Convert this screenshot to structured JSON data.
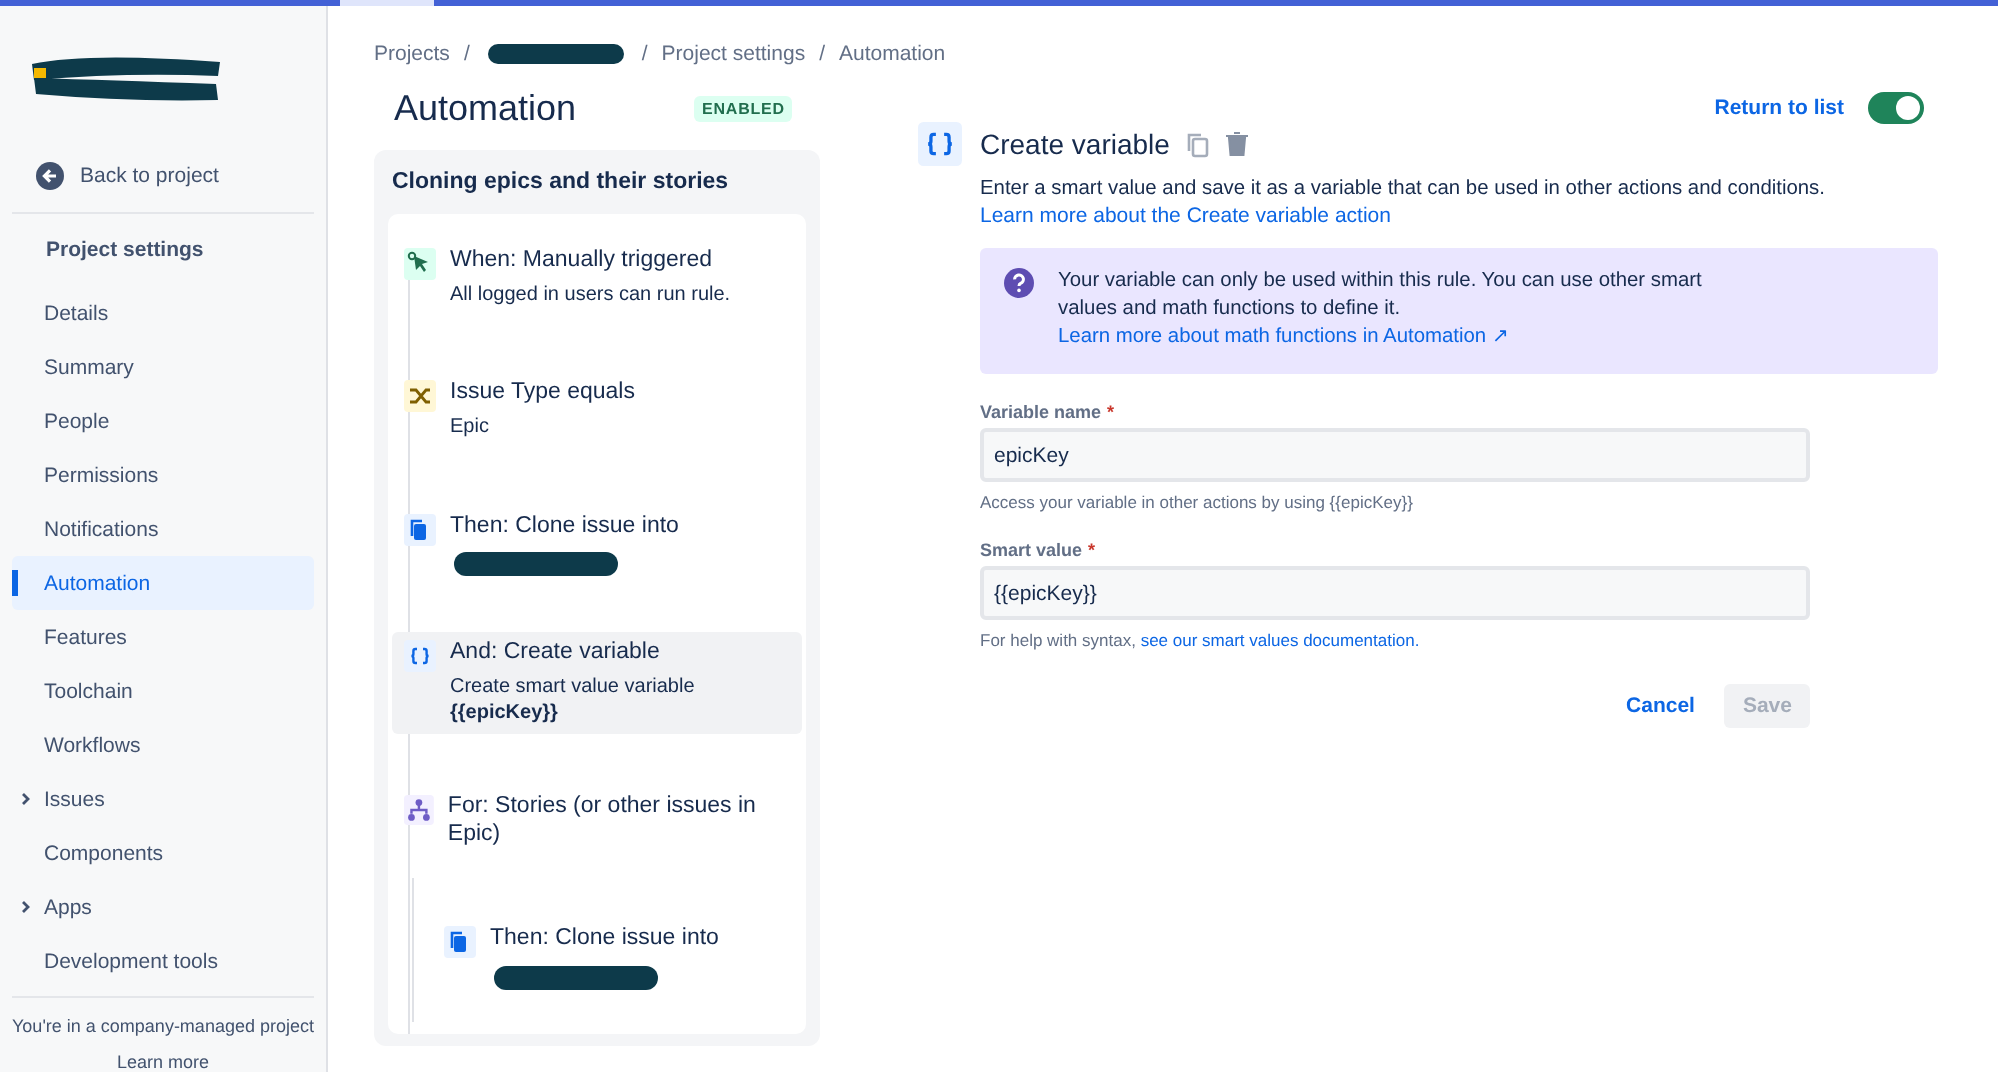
{
  "sidebar": {
    "logo_redacted": true,
    "back_link": "Back to project",
    "heading": "Project settings",
    "items": [
      {
        "label": "Details",
        "selected": false,
        "expandable": false
      },
      {
        "label": "Summary",
        "selected": false,
        "expandable": false
      },
      {
        "label": "People",
        "selected": false,
        "expandable": false
      },
      {
        "label": "Permissions",
        "selected": false,
        "expandable": false
      },
      {
        "label": "Notifications",
        "selected": false,
        "expandable": false
      },
      {
        "label": "Automation",
        "selected": true,
        "expandable": false
      },
      {
        "label": "Features",
        "selected": false,
        "expandable": false
      },
      {
        "label": "Toolchain",
        "selected": false,
        "expandable": false
      },
      {
        "label": "Workflows",
        "selected": false,
        "expandable": false
      },
      {
        "label": "Issues",
        "selected": false,
        "expandable": true
      },
      {
        "label": "Components",
        "selected": false,
        "expandable": false
      },
      {
        "label": "Apps",
        "selected": false,
        "expandable": true
      },
      {
        "label": "Development tools",
        "selected": false,
        "expandable": false
      }
    ],
    "footer": "You're in a company-managed project",
    "footer_link": "Learn more"
  },
  "breadcrumb_separator": "/",
  "breadcrumbs": [
    {
      "kind": "text",
      "label": "Projects"
    },
    {
      "kind": "redacted"
    },
    {
      "kind": "text",
      "label": "Project settings"
    },
    {
      "kind": "text",
      "label": "Automation"
    }
  ],
  "page_title": "Automation",
  "status_badge": "ENABLED",
  "return_link": "Return to list",
  "rule_enabled": true,
  "rule": {
    "name": "Cloning epics and their stories",
    "steps": [
      {
        "kind": "trigger",
        "title": "When: Manually triggered",
        "detail": "All logged in users can run rule.",
        "redacted": false,
        "selected": false
      },
      {
        "kind": "condition",
        "title": "Issue Type equals",
        "detail": "Epic",
        "redacted": false,
        "selected": false
      },
      {
        "kind": "clone",
        "title": "Then: Clone issue into",
        "redacted": true,
        "selected": false
      },
      {
        "kind": "variable",
        "title": "And: Create variable",
        "detail": "Create smart value variable **{{epicKey}}**",
        "redacted": false,
        "selected": true
      },
      {
        "kind": "branch",
        "title": "For: Stories (or other issues in Epic)",
        "redacted": false,
        "selected": false,
        "children": [
          {
            "kind": "clone",
            "title": "Then: Clone issue into",
            "redacted": true,
            "selected": false
          }
        ]
      }
    ]
  },
  "editor": {
    "title": "Create variable",
    "description": "Enter a smart value and save it as a variable that can be used in other actions and conditions.",
    "learn_link": "Learn more about the Create variable action",
    "info": "Your variable can only be used within this rule. You can use other smart values and math functions to define it.",
    "info_link": "Learn more about math functions in Automation ↗",
    "fields": [
      {
        "label": "Variable name",
        "required_mark": "*",
        "value": "epicKey",
        "help": "Access your variable in other actions by using {{epicKey}}"
      },
      {
        "label": "Smart value",
        "required_mark": "*",
        "value": "{{epicKey}}",
        "help": "For help with syntax,",
        "help_link": "see our smart values documentation."
      }
    ],
    "cancel": "Cancel",
    "save": "Save",
    "save_disabled": true
  }
}
